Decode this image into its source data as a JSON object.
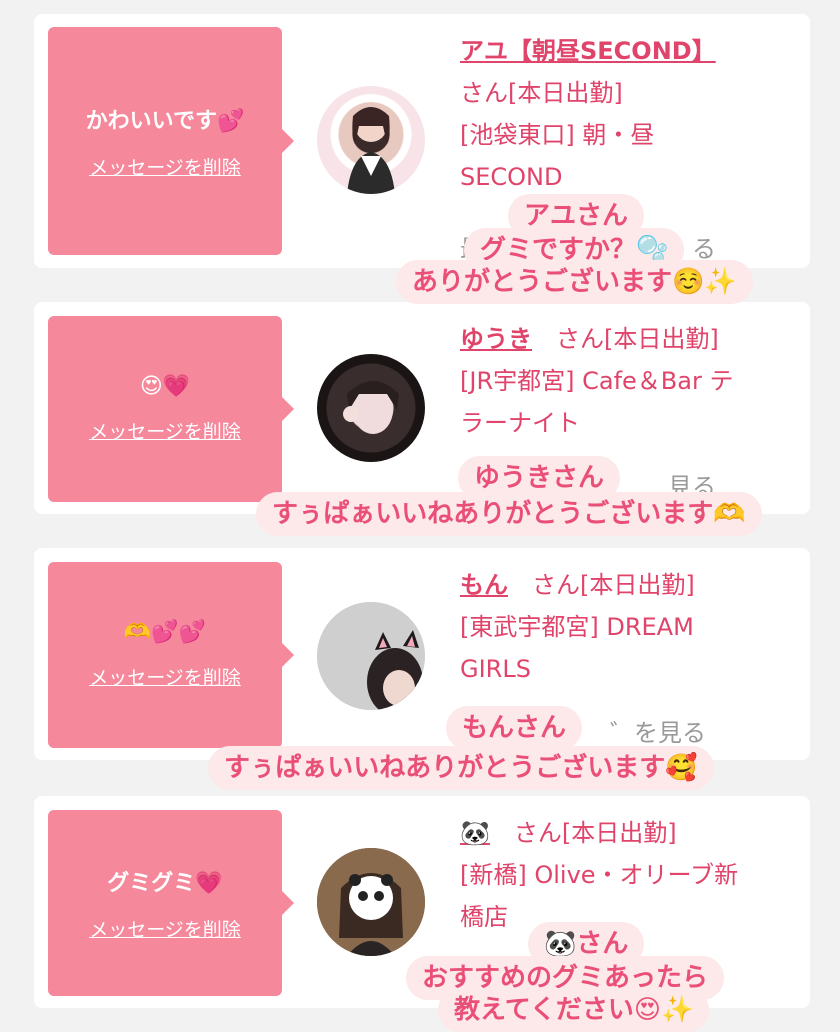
{
  "cards": [
    {
      "message": "かわいいです💕",
      "delete_label": "メッセージを削除",
      "name": "アユ【朝昼SECOND】",
      "line1": "さん[本日出勤]",
      "line2": "[池袋東口] 朝・昼",
      "line3": "SECOND",
      "partial": "最",
      "partial_end": "る"
    },
    {
      "message": "😍💗",
      "delete_label": "メッセージを削除",
      "name": "ゆうき",
      "line1": "さん[本日出勤]",
      "line2": "[JR宇都宮] Cafe＆Bar テ",
      "line3": "ラーナイト",
      "partial": "見る"
    },
    {
      "message": "🫶💕💕",
      "delete_label": "メッセージを削除",
      "name": "もん",
      "line1": "さん[本日出勤]",
      "line2": "[東武宇都宮] DREAM",
      "line3": "GIRLS",
      "partial": "゛を見る"
    },
    {
      "message": "グミグミ💗",
      "delete_label": "メッセージを削除",
      "name": "🐼",
      "line1": "さん[本日出勤]",
      "line2": "[新橋] Olive・オリーブ新",
      "line3": "橋店"
    }
  ],
  "captions": {
    "c1a": "アユさん",
    "c1b": "グミですか？🫧",
    "c1c": "ありがとうございます☺️✨",
    "c2a": "ゆうきさん",
    "c2b": "すぅぱぁいいねありがとうございます🫶",
    "c3a": "もんさん",
    "c3b": "すぅぱぁいいねありがとうございます🥰",
    "c4a": "🐼さん",
    "c4b": "おすすめのグミあったら",
    "c4c": "教えてください😍✨"
  },
  "colors": {
    "accent": "#e0446a",
    "bubble": "#f6889c",
    "caption_bg": "#fde8ea",
    "caption_text": "#ea4f77"
  },
  "icons": [
    "panda-emoji",
    "avatar-photo"
  ]
}
